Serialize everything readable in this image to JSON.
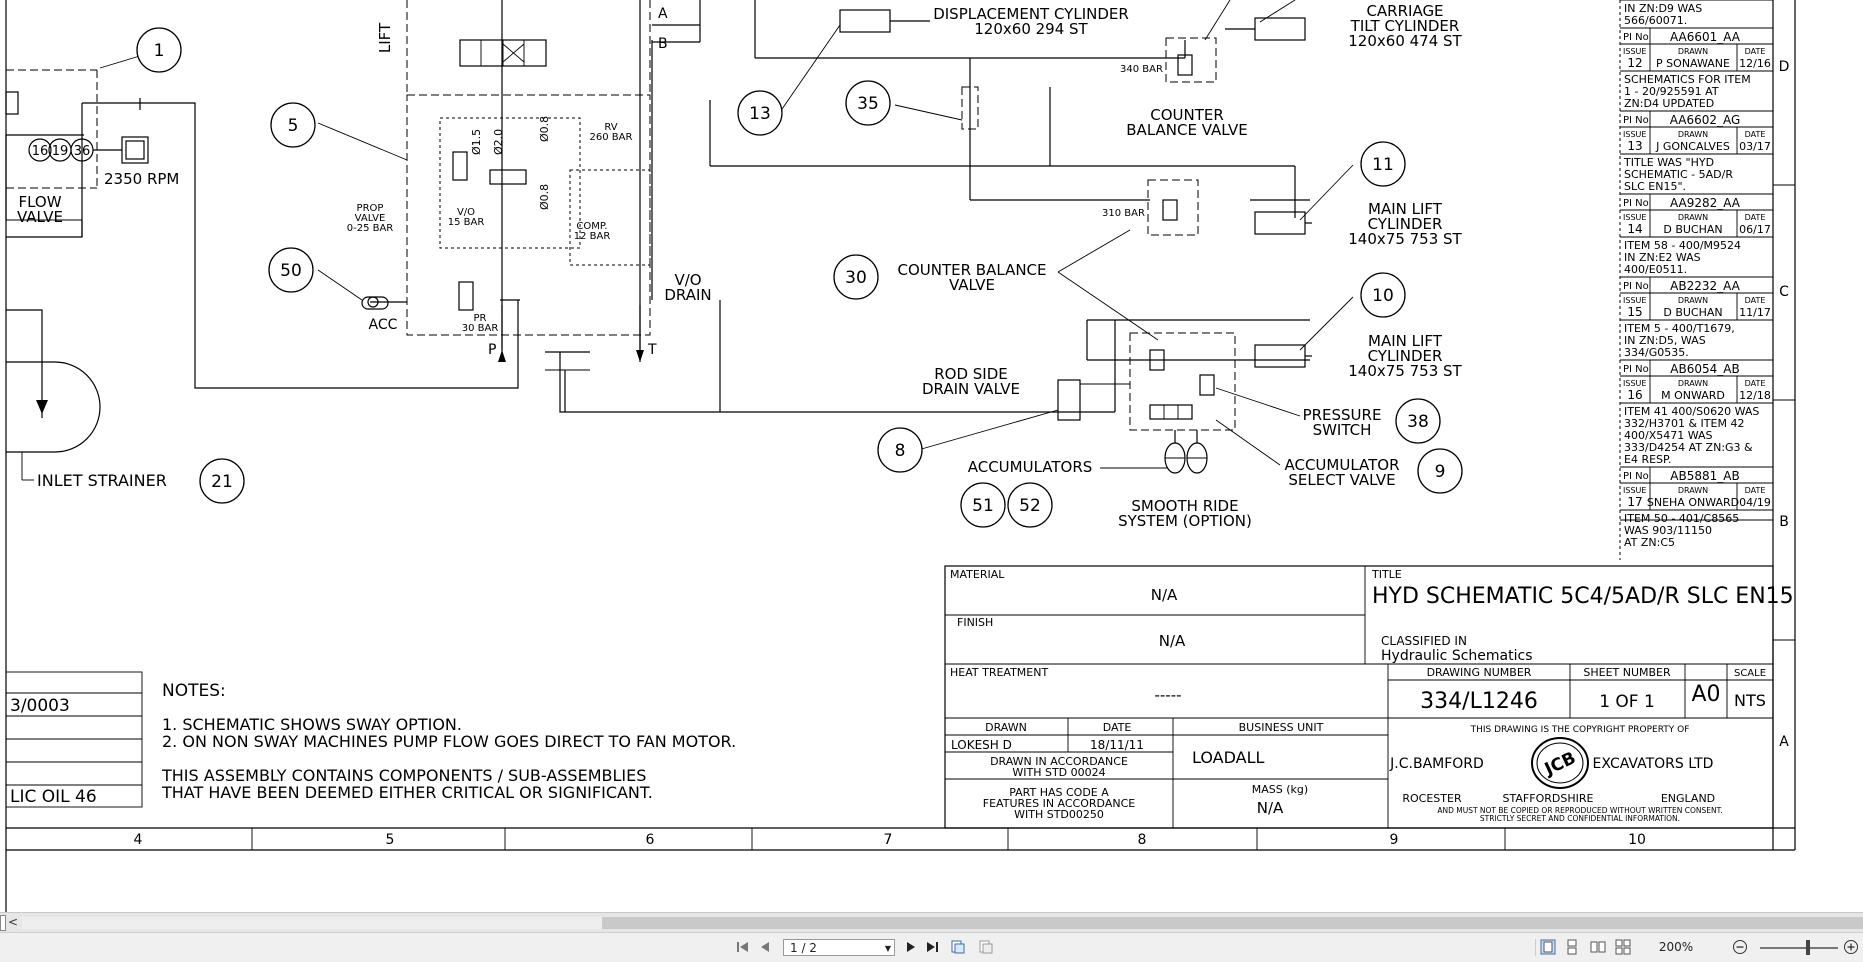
{
  "drawing": {
    "callouts": {
      "c1": "1",
      "c5": "5",
      "c50": "50",
      "c13": "13",
      "c35": "35",
      "c11": "11",
      "c30": "30",
      "c10": "10",
      "c8": "8",
      "c38": "38",
      "c9": "9",
      "c51": "51",
      "c52": "52",
      "c21": "21",
      "p16": "16",
      "p19": "19",
      "p36": "36"
    },
    "labels": {
      "lift": "LIFT",
      "port_a": "A",
      "port_b": "B",
      "port_p": "P",
      "port_t": "T",
      "rpm": "2350 RPM",
      "flow_valve_1": "FLOW",
      "flow_valve_2": "VALVE",
      "prop_valve_1": "PROP",
      "prop_valve_2": "VALVE",
      "prop_valve_3": "0-25 BAR",
      "vo_1": "V/O",
      "vo_2": "15 BAR",
      "comp_1": "COMP.",
      "comp_2": "12 BAR",
      "rv_1": "RV",
      "rv_2": "260 BAR",
      "pr_1": "PR",
      "pr_2": "30 BAR",
      "acc": "ACC",
      "d15": "Ø1.5",
      "d20": "Ø2.0",
      "d08a": "Ø0.8",
      "d08b": "Ø0.8",
      "vo_drain_1": "V/O",
      "vo_drain_2": "DRAIN",
      "disp_cyl_1": "DISPLACEMENT CYLINDER",
      "disp_cyl_2": "120x60 294 ST",
      "carriage_1": "CARRIAGE",
      "carriage_2": "TILT CYLINDER",
      "carriage_3": "120x60 474 ST",
      "bar340": "340 BAR",
      "cbv_1": "COUNTER",
      "cbv_2": "BALANCE VALVE",
      "bar310": "310 BAR",
      "main_lift_1a": "MAIN LIFT",
      "main_lift_1b": "CYLINDER",
      "main_lift_1c": "140x75 753 ST",
      "main_lift_2a": "MAIN LIFT",
      "main_lift_2b": "CYLINDER",
      "main_lift_2c": "140x75 753 ST",
      "cbv2_1": "COUNTER BALANCE",
      "cbv2_2": "VALVE",
      "rod_drain_1": "ROD SIDE",
      "rod_drain_2": "DRAIN VALVE",
      "pressure_switch_1": "PRESSURE",
      "pressure_switch_2": "SWITCH",
      "accumulators": "ACCUMULATORS",
      "acc_select_1": "ACCUMULATOR",
      "acc_select_2": "SELECT VALVE",
      "smooth_ride_1": "SMOOTH RIDE",
      "smooth_ride_2": "SYSTEM (OPTION)",
      "inlet_strainer": "INLET STRAINER"
    },
    "notes": {
      "heading": "NOTES:",
      "n1": "1. SCHEMATIC SHOWS SWAY OPTION.",
      "n2": "2. ON NON SWAY MACHINES PUMP FLOW GOES DIRECT TO FAN MOTOR.",
      "n3a": "THIS ASSEMBLY CONTAINS COMPONENTS / SUB-ASSEMBLIES",
      "n3b": "THAT HAVE BEEN DEEMED EITHER CRITICAL OR SIGNIFICANT.",
      "left_1": "3/0003",
      "left_2": "LIC OIL 46"
    },
    "revisions": [
      {
        "text": [
          "IN ZN:D9 WAS",
          "566/60071."
        ]
      },
      {
        "pi_label": "PI No",
        "pi": "AA6601_AA",
        "issue": "12",
        "drawn": "P SONAWANE",
        "date": "12/16",
        "text": [
          "SCHEMATICS FOR ITEM",
          "1 - 20/925591 AT",
          "ZN:D4 UPDATED"
        ]
      },
      {
        "pi_label": "PI No",
        "pi": "AA6602_AG",
        "issue": "13",
        "drawn": "J GONCALVES",
        "date": "03/17",
        "text": [
          "TITLE WAS \"HYD",
          "SCHEMATIC - 5AD/R",
          "SLC EN15\"."
        ]
      },
      {
        "pi_label": "PI No",
        "pi": "AA9282_AA",
        "issue": "14",
        "drawn": "D BUCHAN",
        "date": "06/17",
        "text": [
          "ITEM 58 - 400/M9524",
          "IN ZN:E2 WAS",
          "400/E0511."
        ]
      },
      {
        "pi_label": "PI No",
        "pi": "AB2232_AA",
        "issue": "15",
        "drawn": "D BUCHAN",
        "date": "11/17",
        "text": [
          "ITEM 5 - 400/T1679,",
          "IN ZN:D5, WAS",
          "334/G0535."
        ]
      },
      {
        "pi_label": "PI No",
        "pi": "AB6054_AB",
        "issue": "16",
        "drawn": "M ONWARD",
        "date": "12/18",
        "text": [
          "ITEM 41 400/S0620 WAS",
          "332/H3701 & ITEM 42",
          "400/X5471 WAS",
          "333/D4254 AT ZN:G3 &",
          "E4 RESP."
        ]
      },
      {
        "pi_label": "PI No",
        "pi": "AB5881_AB",
        "issue": "17",
        "drawn": "SNEHA ONWARD",
        "date": "04/19",
        "text": [
          "ITEM 50 - 401/C8565",
          "WAS 903/11150",
          "AT ZN:C5"
        ]
      }
    ],
    "rev_headers": {
      "issue": "ISSUE",
      "drawn": "DRAWN",
      "date": "DATE"
    },
    "zones_right": [
      "D",
      "C",
      "B",
      "A"
    ],
    "zones_bottom": [
      "4",
      "5",
      "6",
      "7",
      "8",
      "9",
      "10"
    ],
    "title_block": {
      "material_label": "MATERIAL",
      "material": "N/A",
      "finish_label": "FINISH",
      "finish": "N/A",
      "heat_label": "HEAT TREATMENT",
      "heat": "-----",
      "title_label": "TITLE",
      "title": "HYD SCHEMATIC 5C4/5AD/R SLC EN15",
      "classified_label": "CLASSIFIED IN",
      "classified": "Hydraulic Schematics",
      "drawing_number_label": "DRAWING NUMBER",
      "drawing_number": "334/L1246",
      "sheet_number_label": "SHEET NUMBER",
      "sheet_number": "1 OF 1",
      "size": "A0",
      "scale_label": "SCALE",
      "scale": "NTS",
      "drawn_label": "DRAWN",
      "drawn": "LOKESH D",
      "date_label": "DATE",
      "date": "18/11/11",
      "bu_label": "BUSINESS UNIT",
      "bu": "LOADALL",
      "std_1": "DRAWN IN ACCORDANCE",
      "std_2": "WITH STD 00024",
      "code_1": "PART HAS CODE  A",
      "code_2": "FEATURES IN ACCORDANCE",
      "code_3": "WITH STD00250",
      "mass_label": "MASS (kg)",
      "mass": "N/A",
      "copyright": "THIS DRAWING IS THE COPYRIGHT PROPERTY OF",
      "company_left": "J.C.BAMFORD",
      "company_right": "EXCAVATORS LTD",
      "logo": "JCB",
      "addr_1": "ROCESTER",
      "addr_2": "STAFFORDSHIRE",
      "addr_3": "ENGLAND",
      "legal_1": "AND MUST NOT BE COPIED OR REPRODUCED WITHOUT WRITTEN CONSENT.",
      "legal_2": "STRICTLY SECRET AND CONFIDENTIAL INFORMATION."
    }
  },
  "viewer": {
    "page_field": "1 / 2",
    "zoom": "200%",
    "scroll_left_arrow": "<"
  }
}
